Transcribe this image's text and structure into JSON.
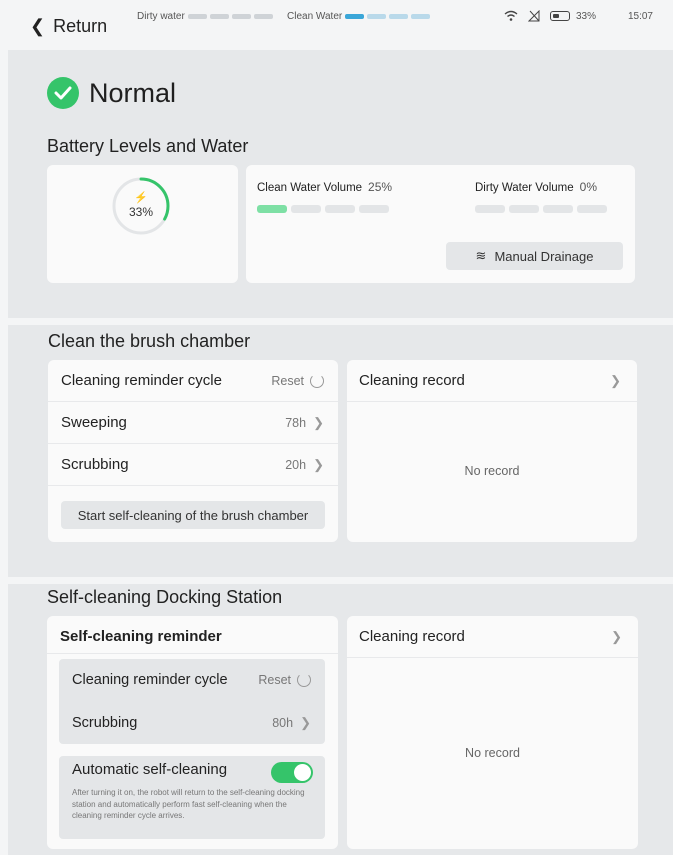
{
  "topbar": {
    "back_label": "Return",
    "dirty_water_label": "Dirty water",
    "clean_water_label": "Clean Water",
    "dirty_segments": [
      false,
      false,
      false,
      false
    ],
    "clean_segments": [
      true,
      false,
      false,
      false
    ],
    "battery_text": "33%",
    "time": "15:07"
  },
  "status": {
    "label": "Normal"
  },
  "battery_water": {
    "title": "Battery Levels and Water",
    "battery_percent": "33%",
    "battery_level": 0.33,
    "clean_water_label": "Clean Water Volume",
    "clean_water_value": "25%",
    "clean_water_segments": [
      true,
      false,
      false,
      false
    ],
    "dirty_water_label": "Dirty Water Volume",
    "dirty_water_value": "0%",
    "dirty_water_segments": [
      false,
      false,
      false,
      false
    ],
    "drain_button": "Manual Drainage"
  },
  "brush_chamber": {
    "title": "Clean the brush chamber",
    "rows": [
      {
        "label": "Cleaning reminder cycle",
        "value": "Reset"
      },
      {
        "label": "Sweeping",
        "value": "78h"
      },
      {
        "label": "Scrubbing",
        "value": "20h"
      }
    ],
    "start_button": "Start self-cleaning of the brush chamber",
    "record_title": "Cleaning record",
    "no_record": "No record"
  },
  "docking_station": {
    "title": "Self-cleaning Docking Station",
    "reminder_title": "Self-cleaning reminder",
    "rows": [
      {
        "label": "Cleaning reminder cycle",
        "value": "Reset"
      },
      {
        "label": "Scrubbing",
        "value": "80h"
      }
    ],
    "auto_title": "Automatic self-cleaning",
    "auto_enabled": true,
    "auto_desc": "After turning it on, the robot will return to the self-cleaning docking station and automatically perform fast self-cleaning when the cleaning reminder cycle arrives.",
    "record_title": "Cleaning record",
    "no_record": "No record"
  },
  "colors": {
    "accent_green": "#35c46a",
    "clean_water_blue": "#3aa6d8",
    "water_green": "#7ee0a5"
  }
}
